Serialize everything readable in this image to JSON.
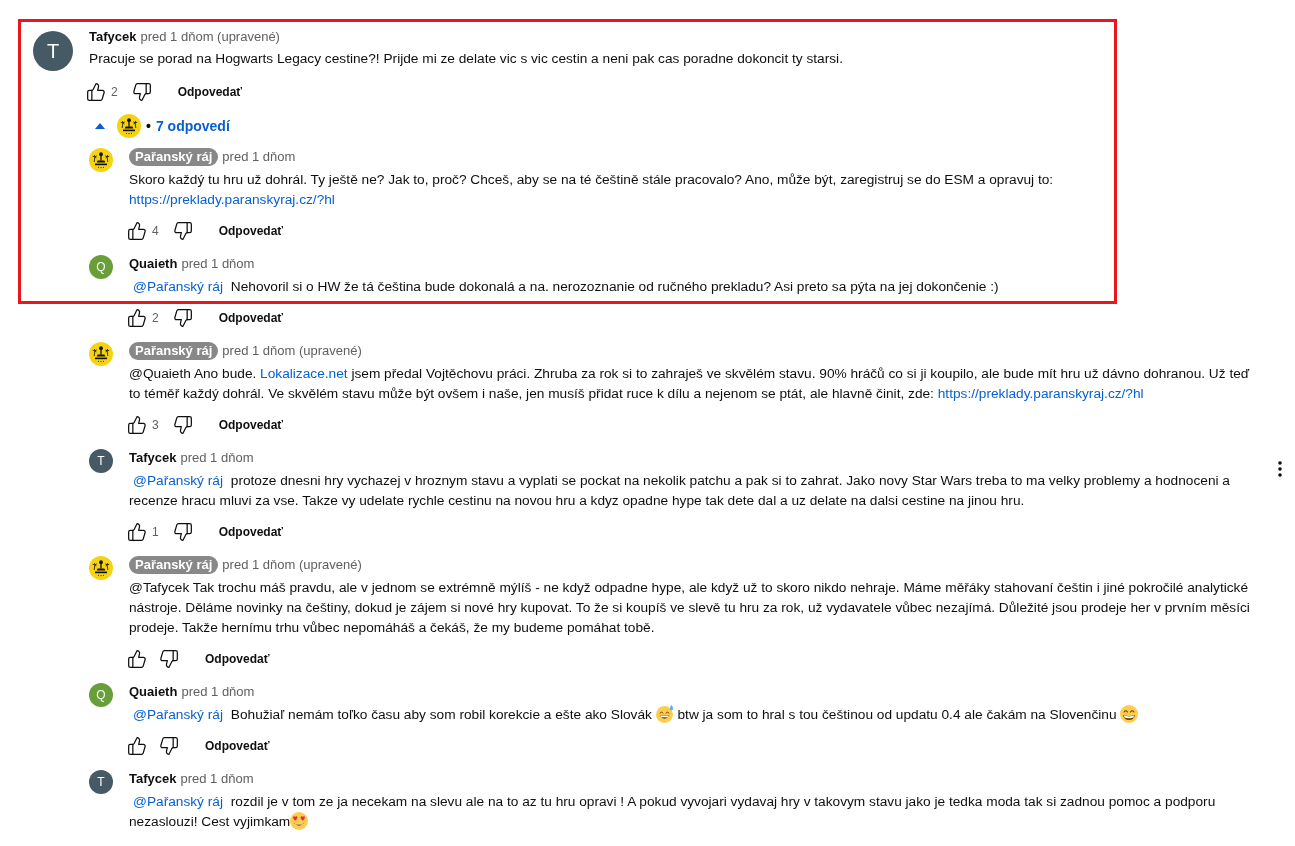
{
  "comment": {
    "author": "Tafycek",
    "creator": false,
    "time": "pred 1 dňom (upravené)",
    "avatar": {
      "kind": "letter",
      "initial": "T",
      "color": "#455a64"
    },
    "body": [
      {
        "kind": "text",
        "text": "Pracuje se porad na Hogwarts Legacy cestine?! Prijde mi ze delate vic s vic cestin a neni pak cas poradne dokoncit ty starsi."
      }
    ],
    "likes": "2",
    "reply_label": "Odpovedať",
    "highlighted": true,
    "menu_visible": false
  },
  "replies_toggle": {
    "expanded": true,
    "avatar": {
      "kind": "logo"
    },
    "separator": "•",
    "label": "7 odpovedí"
  },
  "replies": [
    {
      "author": "Pařanský ráj",
      "creator": true,
      "time": "pred 1 dňom",
      "avatar": {
        "kind": "logo"
      },
      "body": [
        {
          "kind": "text",
          "text": "Skoro každý tu hru už dohrál. Ty ještě ne? Jak to, proč? Chceš, aby se na té češtině stále pracovalo? Ano, může být, zaregistruj se do ESM a opravuj to: "
        },
        {
          "kind": "link",
          "text": "https://preklady.paranskyraj.cz/?hl"
        }
      ],
      "likes": "4",
      "reply_label": "Odpovedať",
      "highlighted": true,
      "menu_visible": false
    },
    {
      "author": "Quaieth",
      "creator": false,
      "time": "pred 1 dňom",
      "avatar": {
        "kind": "letter",
        "initial": "Q",
        "color": "#689f38"
      },
      "body": [
        {
          "kind": "mention",
          "text": "@Pařanský ráj"
        },
        {
          "kind": "text",
          "text": " Nehovoril si o HW že tá čeština bude dokonalá a na. nerozoznanie od ručného prekladu? Asi preto sa pýta na jej dokončenie :)"
        }
      ],
      "likes": "2",
      "reply_label": "Odpovedať",
      "highlighted": true,
      "menu_visible": false
    },
    {
      "author": "Pařanský ráj",
      "creator": true,
      "time": "pred 1 dňom (upravené)",
      "avatar": {
        "kind": "logo"
      },
      "body": [
        {
          "kind": "text",
          "text": "@Quaieth Ano bude. "
        },
        {
          "kind": "link",
          "text": "Lokalizace.net"
        },
        {
          "kind": "text",
          "text": " jsem předal Vojtěchovu práci. Zhruba za rok si to zahraješ ve skvělém stavu. 90% hráčů co si ji koupilo, ale bude mít hru už dávno dohranou. Už teď to téměř každý dohrál. Ve skvělém stavu může být ovšem i naše, jen musíš přidat ruce k dílu a nejenom se ptát, ale hlavně činit, zde: "
        },
        {
          "kind": "link",
          "text": "https://preklady.paranskyraj.cz/?hl"
        }
      ],
      "likes": "3",
      "reply_label": "Odpovedať",
      "highlighted": false,
      "menu_visible": false
    },
    {
      "author": "Tafycek",
      "creator": false,
      "time": "pred 1 dňom",
      "avatar": {
        "kind": "letter",
        "initial": "T",
        "color": "#455a64"
      },
      "body": [
        {
          "kind": "mention",
          "text": "@Pařanský ráj"
        },
        {
          "kind": "text",
          "text": " protoze dnesni hry vychazej v hroznym stavu a vyplati se pockat na nekolik patchu a pak si to zahrat. Jako novy Star Wars treba to ma velky problemy a hodnoceni a recenze hracu mluvi za vse. Takze vy udelate rychle cestinu na novou hru a kdyz opadne hype tak dete dal a uz delate na dalsi cestine na jinou hru."
        }
      ],
      "likes": "1",
      "reply_label": "Odpovedať",
      "highlighted": false,
      "menu_visible": true
    },
    {
      "author": "Pařanský ráj",
      "creator": true,
      "time": "pred 1 dňom (upravené)",
      "avatar": {
        "kind": "logo"
      },
      "body": [
        {
          "kind": "text",
          "text": "@Tafycek Tak trochu máš pravdu, ale v jednom se extrémně mýlíš - ne když odpadne hype, ale když už to skoro nikdo nehraje. Máme měřáky stahovaní češtin i jiné pokročilé analytické nástroje. Děláme novinky na češtiny, dokud je zájem si nové hry kupovat. To že si koupíš ve slevě tu hru za rok, už vydavatele vůbec nezajímá. Důležité jsou prodeje her v prvním měsíci prodeje. Takže hernímu trhu vůbec nepomáháš a čekáš, že my budeme pomáhat tobě."
        }
      ],
      "reply_label": "Odpovedať",
      "highlighted": false,
      "menu_visible": false
    },
    {
      "author": "Quaieth",
      "creator": false,
      "time": "pred 1 dňom",
      "avatar": {
        "kind": "letter",
        "initial": "Q",
        "color": "#689f38"
      },
      "body": [
        {
          "kind": "mention",
          "text": "@Pařanský ráj"
        },
        {
          "kind": "text",
          "text": " Bohužiaľ nemám toľko času aby som robil korekcie a ešte ako Slovák "
        },
        {
          "kind": "sweatsmile"
        },
        {
          "kind": "text",
          "text": " btw ja som to hral s tou češtinou od updatu 0.4 ale čakám na Slovenčinu "
        },
        {
          "kind": "grin"
        }
      ],
      "reply_label": "Odpovedať",
      "highlighted": false,
      "menu_visible": false
    },
    {
      "author": "Tafycek",
      "creator": false,
      "time": "pred 1 dňom",
      "avatar": {
        "kind": "letter",
        "initial": "T",
        "color": "#455a64"
      },
      "body": [
        {
          "kind": "mention",
          "text": "@Pařanský ráj"
        },
        {
          "kind": "text",
          "text": " rozdil je v tom ze ja necekam na slevu ale na to az tu hru opravi ! A pokud vyvojari vydavaj hry v takovym stavu jako je tedka moda tak si zadnou pomoc a podporu nezaslouzi! Cest vyjimkam"
        },
        {
          "kind": "hearteyes"
        }
      ],
      "highlighted": false,
      "menu_visible": false
    }
  ]
}
